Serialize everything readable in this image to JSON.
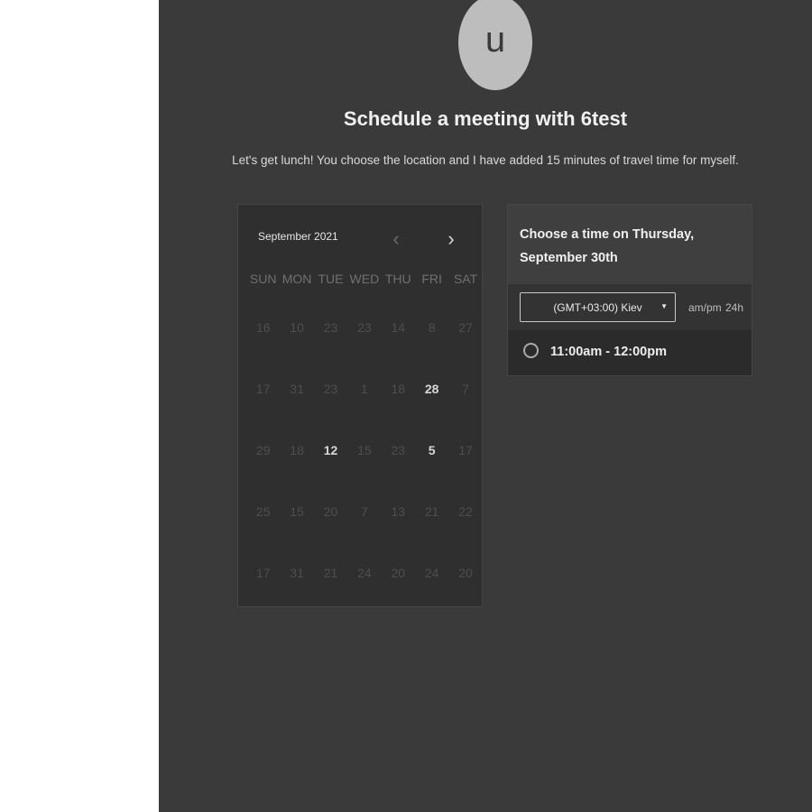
{
  "avatar": {
    "initial": "u"
  },
  "header": {
    "title": "Schedule a meeting with 6test",
    "description": "Let's get lunch! You choose the location and I have added 15 minutes of travel time for myself."
  },
  "calendar": {
    "month_label": "September 2021",
    "prev_icon": "chevron-left-icon",
    "next_icon": "chevron-right-icon",
    "prev_glyph": "‹",
    "next_glyph": "›",
    "weekdays": [
      "SUN",
      "MON",
      "TUE",
      "WED",
      "THU",
      "FRI",
      "SAT"
    ],
    "weeks": [
      [
        "16",
        "10",
        "23",
        "23",
        "14",
        "8",
        "27"
      ],
      [
        "17",
        "31",
        "23",
        "1",
        "18",
        "28",
        "7"
      ],
      [
        "29",
        "18",
        "12",
        "15",
        "23",
        "5",
        "17"
      ],
      [
        "25",
        "15",
        "20",
        "7",
        "13",
        "21",
        "22"
      ],
      [
        "17",
        "31",
        "21",
        "24",
        "20",
        "24",
        "20"
      ]
    ],
    "available_days": [
      "28",
      "12",
      "5"
    ]
  },
  "times": {
    "heading": "Choose a time on Thursday, September 30th",
    "timezone": "(GMT+03:00) Kiev",
    "format_ampm": "am/pm",
    "format_24h": "24h",
    "slots": [
      "11:00am - 12:00pm"
    ]
  },
  "colors": {
    "panel_bg": "#3a3a3a",
    "calendar_bg": "#2f2f2f",
    "avatar_bg": "#bdbdbd"
  }
}
